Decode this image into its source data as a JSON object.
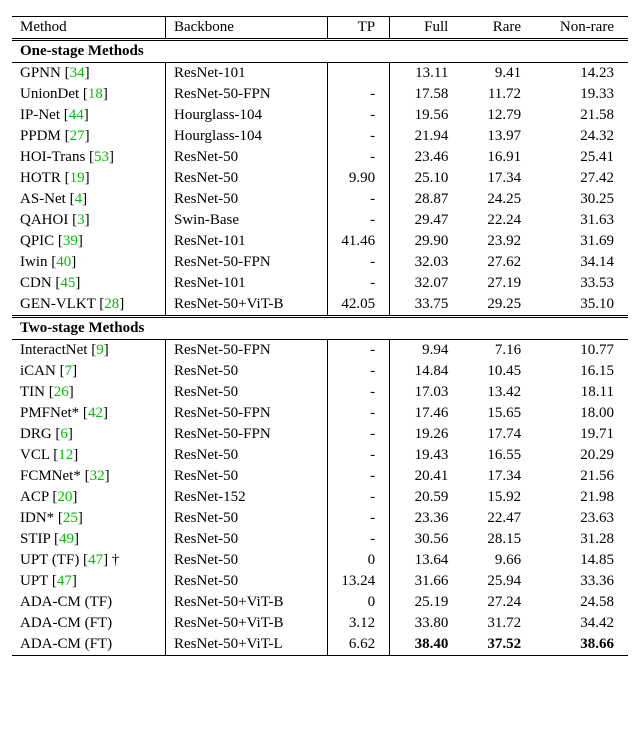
{
  "headers": {
    "method": "Method",
    "backbone": "Backbone",
    "tp": "TP",
    "full": "Full",
    "rare": "Rare",
    "nonrare": "Non-rare"
  },
  "section_one": "One-stage Methods",
  "section_two": "Two-stage Methods",
  "one_stage": [
    {
      "method": "GPNN",
      "cite": "34",
      "backbone": "ResNet-101",
      "tp": "",
      "full": "13.11",
      "rare": "9.41",
      "nonrare": "14.23"
    },
    {
      "method": "UnionDet",
      "cite": "18",
      "backbone": "ResNet-50-FPN",
      "tp": "-",
      "full": "17.58",
      "rare": "11.72",
      "nonrare": "19.33"
    },
    {
      "method": "IP-Net",
      "cite": "44",
      "backbone": "Hourglass-104",
      "tp": "-",
      "full": "19.56",
      "rare": "12.79",
      "nonrare": "21.58"
    },
    {
      "method": "PPDM",
      "cite": "27",
      "backbone": "Hourglass-104",
      "tp": "-",
      "full": "21.94",
      "rare": "13.97",
      "nonrare": "24.32"
    },
    {
      "method": "HOI-Trans",
      "cite": "53",
      "backbone": "ResNet-50",
      "tp": "-",
      "full": "23.46",
      "rare": "16.91",
      "nonrare": "25.41"
    },
    {
      "method": "HOTR",
      "cite": "19",
      "backbone": "ResNet-50",
      "tp": "9.90",
      "full": "25.10",
      "rare": "17.34",
      "nonrare": "27.42"
    },
    {
      "method": "AS-Net",
      "cite": "4",
      "backbone": "ResNet-50",
      "tp": "-",
      "full": "28.87",
      "rare": "24.25",
      "nonrare": "30.25"
    },
    {
      "method": "QAHOI",
      "cite": "3",
      "backbone": "Swin-Base",
      "tp": "-",
      "full": "29.47",
      "rare": "22.24",
      "nonrare": "31.63"
    },
    {
      "method": "QPIC",
      "cite": "39",
      "backbone": "ResNet-101",
      "tp": "41.46",
      "full": "29.90",
      "rare": "23.92",
      "nonrare": "31.69"
    },
    {
      "method": "Iwin",
      "cite": "40",
      "backbone": "ResNet-50-FPN",
      "tp": "-",
      "full": "32.03",
      "rare": "27.62",
      "nonrare": "34.14"
    },
    {
      "method": "CDN",
      "cite": "45",
      "backbone": "ResNet-101",
      "tp": "-",
      "full": "32.07",
      "rare": "27.19",
      "nonrare": "33.53"
    },
    {
      "method": "GEN-VLKT",
      "cite": "28",
      "backbone": "ResNet-50+ViT-B",
      "tp": "42.05",
      "full": "33.75",
      "rare": "29.25",
      "nonrare": "35.10"
    }
  ],
  "two_stage": [
    {
      "method": "InteractNet",
      "cite": "9",
      "backbone": "ResNet-50-FPN",
      "tp": "-",
      "full": "9.94",
      "rare": "7.16",
      "nonrare": "10.77"
    },
    {
      "method": "iCAN",
      "cite": "7",
      "backbone": "ResNet-50",
      "tp": "-",
      "full": "14.84",
      "rare": "10.45",
      "nonrare": "16.15"
    },
    {
      "method": "TIN",
      "cite": "26",
      "backbone": "ResNet-50",
      "tp": "-",
      "full": "17.03",
      "rare": "13.42",
      "nonrare": "18.11"
    },
    {
      "method": "PMFNet*",
      "cite": "42",
      "backbone": "ResNet-50-FPN",
      "tp": "-",
      "full": "17.46",
      "rare": "15.65",
      "nonrare": "18.00"
    },
    {
      "method": "DRG",
      "cite": "6",
      "backbone": "ResNet-50-FPN",
      "tp": "-",
      "full": "19.26",
      "rare": "17.74",
      "nonrare": "19.71"
    },
    {
      "method": "VCL",
      "cite": "12",
      "backbone": "ResNet-50",
      "tp": "-",
      "full": "19.43",
      "rare": "16.55",
      "nonrare": "20.29"
    },
    {
      "method": "FCMNet*",
      "cite": "32",
      "backbone": "ResNet-50",
      "tp": "-",
      "full": "20.41",
      "rare": "17.34",
      "nonrare": "21.56"
    },
    {
      "method": "ACP",
      "cite": "20",
      "backbone": "ResNet-152",
      "tp": "-",
      "full": "20.59",
      "rare": "15.92",
      "nonrare": "21.98"
    },
    {
      "method": "IDN*",
      "cite": "25",
      "backbone": "ResNet-50",
      "tp": "-",
      "full": "23.36",
      "rare": "22.47",
      "nonrare": "23.63"
    },
    {
      "method": "STIP",
      "cite": "49",
      "backbone": "ResNet-50",
      "tp": "-",
      "full": "30.56",
      "rare": "28.15",
      "nonrare": "31.28"
    },
    {
      "method": "UPT (TF)",
      "cite": "47",
      "suffix": " †",
      "backbone": "ResNet-50",
      "tp": "0",
      "full": "13.64",
      "rare": "9.66",
      "nonrare": "14.85"
    },
    {
      "method": "UPT",
      "cite": "47",
      "backbone": "ResNet-50",
      "tp": "13.24",
      "full": "31.66",
      "rare": "25.94",
      "nonrare": "33.36"
    },
    {
      "method": "ADA-CM (TF)",
      "backbone": "ResNet-50+ViT-B",
      "tp": "0",
      "full": "25.19",
      "rare": "27.24",
      "nonrare": "24.58"
    },
    {
      "method": "ADA-CM (FT)",
      "backbone": "ResNet-50+ViT-B",
      "tp": "3.12",
      "full": "33.80",
      "rare": "31.72",
      "nonrare": "34.42"
    },
    {
      "method": "ADA-CM (FT)",
      "backbone": "ResNet-50+ViT-L",
      "tp": "6.62",
      "full": "38.40",
      "rare": "37.52",
      "nonrare": "38.66",
      "bold": true
    }
  ]
}
